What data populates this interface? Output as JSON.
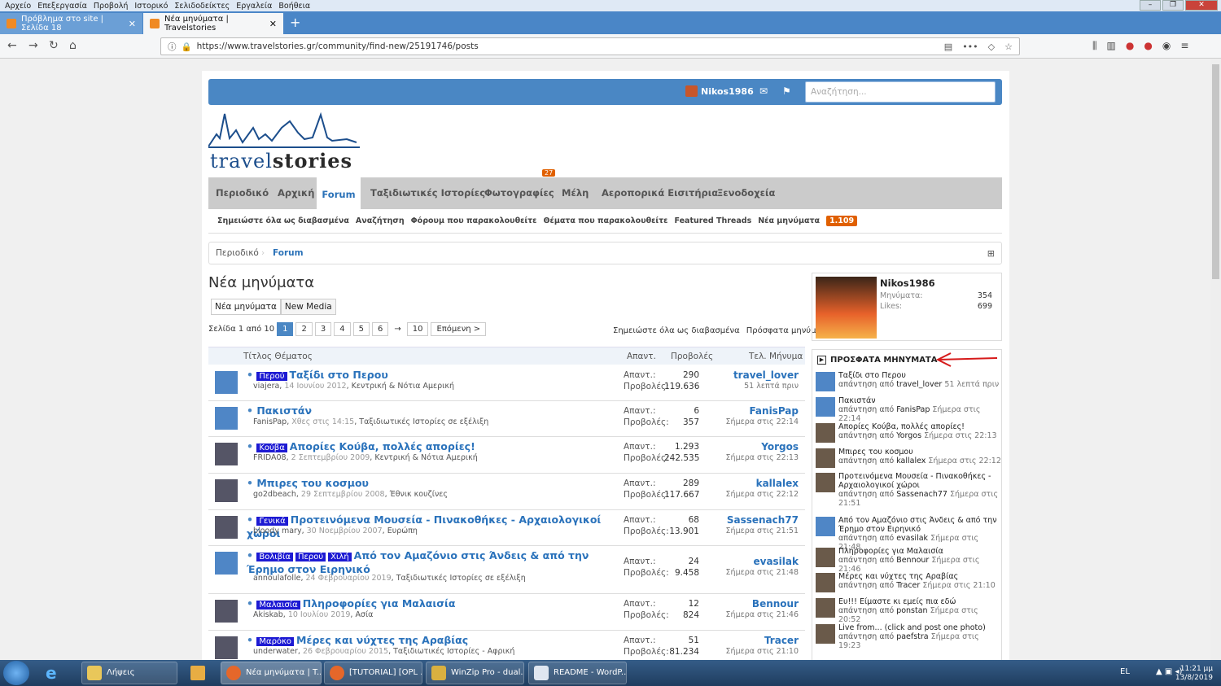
{
  "menubar": [
    "Αρχείο",
    "Επεξεργασία",
    "Προβολή",
    "Ιστορικό",
    "Σελιδοδείκτες",
    "Εργαλεία",
    "Βοήθεια"
  ],
  "tabs": [
    {
      "label": "Πρόβλημα στο site | Σελίδα 18"
    },
    {
      "label": "Νέα μηνύματα | Travelstories"
    }
  ],
  "url": "https://www.travelstories.gr/community/find-new/25191746/posts",
  "topbar": {
    "username": "Nikos1986",
    "search_placeholder": "Αναζήτηση..."
  },
  "logo": {
    "text_a": "travel",
    "text_b": "stories"
  },
  "mainnav": [
    {
      "label": "Περιοδικό"
    },
    {
      "label": "Αρχική"
    },
    {
      "label": "Forum"
    },
    {
      "label": "Ταξιδιωτικές Ιστορίες"
    },
    {
      "label": "Φωτογραφίες"
    },
    {
      "label": "Μέλη"
    },
    {
      "label": "Αεροπορικά Εισιτήρια"
    },
    {
      "label": "Ξενοδοχεία"
    }
  ],
  "badge_photos": "27",
  "subnav": [
    "Σημειώστε όλα ως διαβασμένα",
    "Αναζήτηση",
    "Φόρουμ που παρακολουθείτε",
    "Θέματα που παρακολουθείτε",
    "Featured Threads",
    "Νέα μηνύματα"
  ],
  "subnav_count": "1.109",
  "breadcrumb": [
    "Περιοδικό",
    "Forum"
  ],
  "page_title": "Νέα μηνύματα",
  "page_tabs": [
    "Νέα μηνύματα",
    "New Media"
  ],
  "pager": {
    "label": "Σελίδα 1 από 10",
    "pages": [
      "1",
      "2",
      "3",
      "4",
      "5",
      "6"
    ],
    "dots": "→",
    "last": "10",
    "next": "Επόμενη >"
  },
  "right_links": [
    "Σημειώστε όλα ως διαβασμένα",
    "Πρόσφατα μηνύματα"
  ],
  "columns": {
    "title": "Τίτλος Θέματος",
    "replies": "Απαντ.",
    "views": "Προβολές",
    "last": "Τελ. Μήνυμα"
  },
  "labels": {
    "replies": "Απαντ.:",
    "views": "Προβολές:"
  },
  "threads": [
    {
      "prefixes": [
        "Περού"
      ],
      "title": "Ταξίδι στο Περου",
      "author": "viajera",
      "date": "14 Ιουνίου 2012",
      "forum": "Κεντρική & Νότια Αμερική",
      "replies": "290",
      "views": "119.636",
      "last_user": "travel_lover",
      "last_time": "51 λεπτά πριν"
    },
    {
      "prefixes": [],
      "title": "Πακιστάν",
      "author": "FanisPap",
      "date": "Χθες στις 14:15",
      "forum": "Ταξιδιωτικές Ιστορίες σε εξέλιξη",
      "replies": "6",
      "views": "357",
      "last_user": "FanisPap",
      "last_time": "Σήμερα στις 22:14"
    },
    {
      "prefixes": [
        "Κούβα"
      ],
      "title": "Απορίες Κούβα, πολλές απορίες!",
      "author": "FRIDA08",
      "date": "2 Σεπτεμβρίου 2009",
      "forum": "Κεντρική & Νότια Αμερική",
      "replies": "1.293",
      "views": "242.535",
      "last_user": "Yorgos",
      "last_time": "Σήμερα στις 22:13"
    },
    {
      "prefixes": [],
      "title": "Μπιρες του κοσμου",
      "author": "go2dbeach",
      "date": "29 Σεπτεμβρίου 2008",
      "forum": "Έθνικ κουζίνες",
      "replies": "289",
      "views": "117.667",
      "last_user": "kallalex",
      "last_time": "Σήμερα στις 22:12"
    },
    {
      "prefixes": [
        "Γενικά"
      ],
      "title": "Προτεινόμενα Μουσεία - Πινακοθήκες - Αρχαιολογικοί χώροι",
      "author": "bloody mary",
      "date": "30 Νοεμβρίου 2007",
      "forum": "Ευρώπη",
      "replies": "68",
      "views": "13.901",
      "last_user": "Sassenach77",
      "last_time": "Σήμερα στις 21:51"
    },
    {
      "prefixes": [
        "Βολιβία",
        "Περού",
        "Χιλή"
      ],
      "title": "Από τον Αμαζόνιο στις Άνδεις & από την Έρημο στον Ειρηνικό",
      "author": "annoulafolle",
      "date": "24 Φεβρουαρίου 2019",
      "forum": "Ταξιδιωτικές Ιστορίες σε εξέλιξη",
      "replies": "24",
      "views": "9.458",
      "last_user": "evasilak",
      "last_time": "Σήμερα στις 21:48"
    },
    {
      "prefixes": [
        "Μαλαισία"
      ],
      "title": "Πληροφορίες για Μαλαισία",
      "author": "Akiskab",
      "date": "10 Ιουλίου 2019",
      "forum": "Ασία",
      "replies": "12",
      "views": "824",
      "last_user": "Bennour",
      "last_time": "Σήμερα στις 21:46"
    },
    {
      "prefixes": [
        "Μαρόκο"
      ],
      "title": "Μέρες και νύχτες της Αραβίας",
      "author": "underwater",
      "date": "26 Φεβρουαρίου 2015",
      "forum": "Ταξιδιωτικές Ιστορίες - Αφρική",
      "replies": "51",
      "views": "81.234",
      "last_user": "Tracer",
      "last_time": "Σήμερα στις 21:10"
    }
  ],
  "user_card": {
    "name": "Nikos1986",
    "k1": "Μηνύματα:",
    "v1": "354",
    "k2": "Likes:",
    "v2": "699"
  },
  "recent_title": "ΠΡΟΣΦΑΤΑ ΜΗΝΥΜΑΤΑ",
  "recent_by": "απάντηση από",
  "recent": [
    {
      "title": "Ταξίδι στο Περου",
      "user": "travel_lover",
      "time": "51 λεπτά πριν"
    },
    {
      "title": "Πακιστάν",
      "user": "FanisPap",
      "time": "Σήμερα στις 22:14"
    },
    {
      "title": "Απορίες Κούβα, πολλές απορίες!",
      "user": "Yorgos",
      "time": "Σήμερα στις 22:13"
    },
    {
      "title": "Μπιρες του κοσμου",
      "user": "kallalex",
      "time": "Σήμερα στις 22:12"
    },
    {
      "title": "Προτεινόμενα Μουσεία - Πινακοθήκες - Αρχαιολογικοί χώροι",
      "user": "Sassenach77",
      "time": "Σήμερα στις 21:51"
    },
    {
      "title": "Από τον Αμαζόνιο στις Άνδεις & από την Έρημο στον Ειρηνικό",
      "user": "evasilak",
      "time": "Σήμερα στις 21:48"
    },
    {
      "title": "Πληροφορίες για Μαλαισία",
      "user": "Bennour",
      "time": "Σήμερα στις 21:46"
    },
    {
      "title": "Μέρες και νύχτες της Αραβίας",
      "user": "Tracer",
      "time": "Σήμερα στις 21:10"
    },
    {
      "title": "Ευ!!! Είμαστε κι εμείς πια εδώ",
      "user": "ponstan",
      "time": "Σήμερα στις 20:52"
    },
    {
      "title": "Live from... (click and post one photo)",
      "user": "paefstra",
      "time": "Σήμερα στις 19:23"
    }
  ],
  "taskbar": [
    {
      "label": "Λήψεις"
    },
    {
      "label": "Νέα μηνύματα | T..."
    },
    {
      "label": "[TUTORIAL] [OPL ..."
    },
    {
      "label": "WinZip Pro - dual..."
    },
    {
      "label": "README - WordP..."
    }
  ],
  "tray": {
    "lang": "EL",
    "time": "11:21 μμ",
    "date": "13/8/2019"
  }
}
